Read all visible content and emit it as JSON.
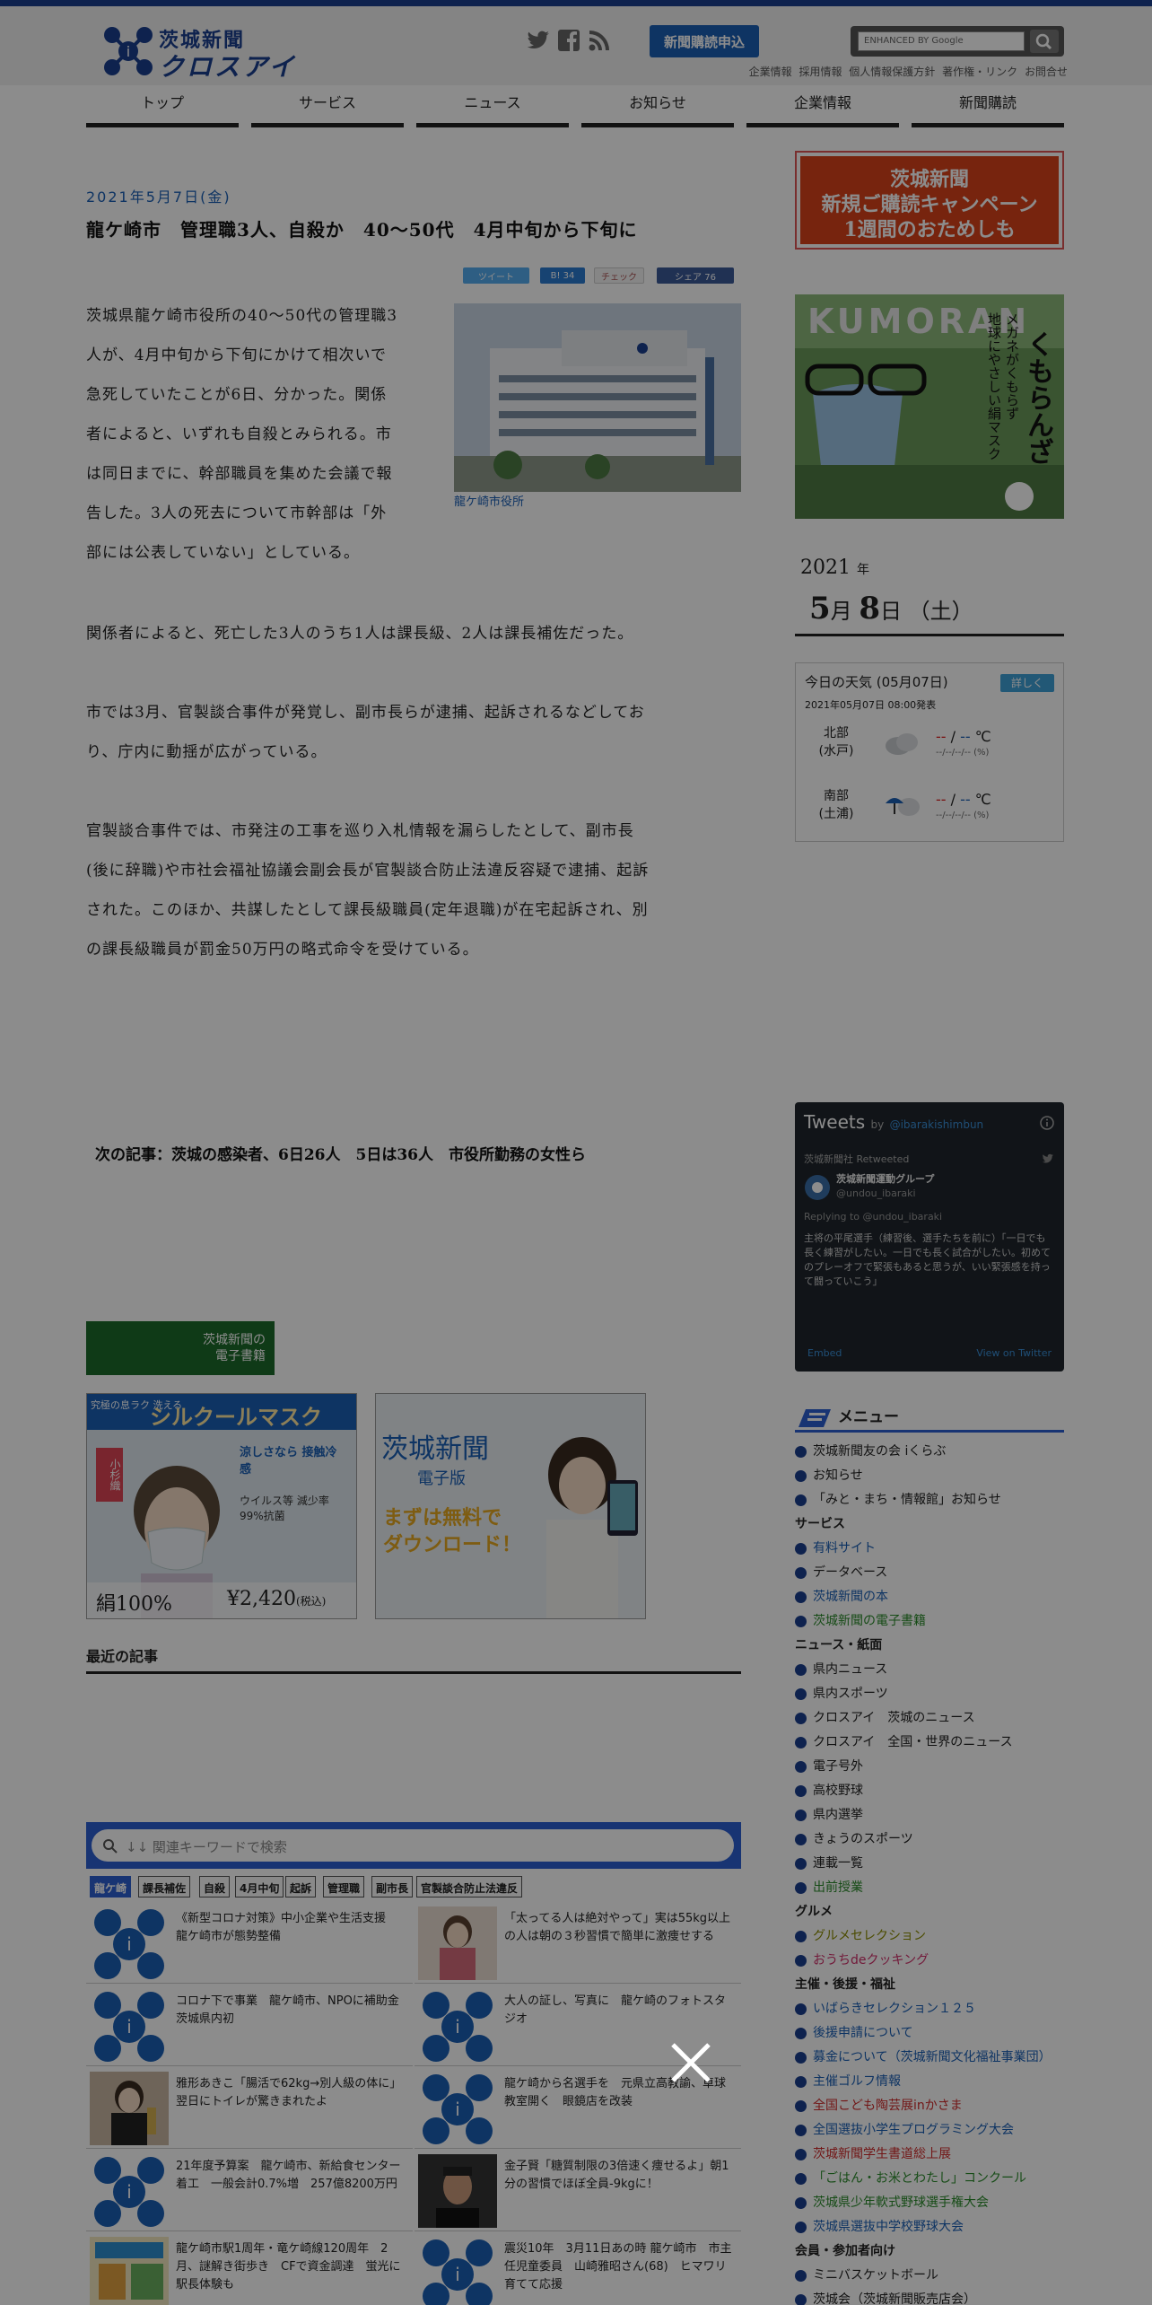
{
  "header": {
    "logo_line1": "茨城新聞",
    "logo_line2": "クロスアイ",
    "subscribe": "新聞購読申込",
    "search_placeholder": "ENHANCED BY Google",
    "toplinks": [
      "企業情報",
      "採用情報",
      "個人情報保護方針",
      "著作権・リンク",
      "お問合せ"
    ]
  },
  "nav": [
    "トップ",
    "サービス",
    "ニュース",
    "お知らせ",
    "企業情報",
    "新聞購読"
  ],
  "article": {
    "date": "2021年5月7日(金)",
    "title": "龍ケ崎市　管理職3人、自殺か　40〜50代　4月中旬から下旬に",
    "share": {
      "tweet": "ツイート",
      "hatena": "B! 34",
      "check": "チェック",
      "facebook": "シェア 76"
    },
    "photo_caption": "龍ケ崎市役所",
    "p1": [
      "茨城県龍ケ崎市役所の40〜50代の管理職3",
      "人が、4月中旬から下旬にかけて相次いで",
      "急死していたことが6日、分かった。関係",
      "者によると、いずれも自殺とみられる。市",
      "は同日までに、幹部職員を集めた会議で報",
      "告した。3人の死去について市幹部は「外",
      "部には公表していない」としている。"
    ],
    "p2": [
      "関係者によると、死亡した3人のうち1人は課長級、2人は課長補佐だった。"
    ],
    "p3": [
      "市では3月、官製談合事件が発覚し、副市長らが逮捕、起訴されるなどしてお",
      "り、庁内に動揺が広がっている。"
    ],
    "p4": [
      "官製談合事件では、市発注の工事を巡り入札情報を漏らしたとして、副市長",
      "(後に辞職)や市社会福祉協議会副会長が官製談合防止法違反容疑で逮捕、起訴",
      "された。このほか、共謀したとして課長級職員(定年退職)が在宅起訴され、別",
      "の課長級職員が罰金50万円の略式命令を受けている。"
    ],
    "next_label": "次の記事：",
    "next_title": "茨城の感染者、6日26人　5日は36人　市役所勤務の女性ら"
  },
  "ads": {
    "ebook": [
      "茨城新聞の",
      "電子書籍"
    ],
    "mask_top": "究極の息ラク 洗える",
    "mask_name": "シルクールマスク",
    "mask_brand": "小杉織",
    "mask_cool": "涼しさなら 接触冷感",
    "mask_virus": "ウイルス等 減少率99%抗菌",
    "mask_silk": "絹100%",
    "mask_price": "¥2,420",
    "mask_tax": "(税込)",
    "ebook2_title": "茨城新聞",
    "ebook2_sub": "電子版",
    "ebook2_msg1": "まずは無料で",
    "ebook2_msg2": "ダウンロード！"
  },
  "recent": {
    "heading": "最近の記事",
    "search_placeholder": "↓↓ 関連キーワードで検索",
    "tags": [
      "龍ケ崎",
      "課長補佐",
      "自殺",
      "4月中旬",
      "起訴",
      "管理職",
      "副市長",
      "官製談合防止法違反"
    ],
    "cards": [
      "《新型コロナ対策》中小企業や生活支援　龍ケ崎市が態勢整備",
      "「太ってる人は絶対やって」実は55kg以上の人は朝の３秒習慣で簡単に激痩せする",
      "コロナ下で事業　龍ケ崎市、NPOに補助金　茨城県内初",
      "大人の証し、写真に　龍ケ崎のフォトスタジオ",
      "雅形あきこ「腸活で62kg→別人級の体に」翌日にトイレが驚きまれたよ",
      "龍ケ崎から名選手を　元県立高教諭、卓球教室開く　眼鏡店を改装",
      "21年度予算案　龍ケ崎市、新給食センター着工　一般会計0.7%増　257億8200万円",
      "金子賢「糖質制限の3倍速く痩せるよ」朝1分の習慣でほぼ全員-9kgに！",
      "龍ケ崎市駅1周年・竜ケ崎線120周年　2月、謎解き街歩き　CFで資金調達　蛍光に駅長体験も",
      "震災10年　3月11日あの時 龍ケ崎市　市主任児童委員　山崎雅昭さん(68)　ヒマワリ育てて応援"
    ]
  },
  "sidebar": {
    "campaign": [
      "茨城新聞",
      "新規ご購読キャンペーン",
      "1週間のおためしも"
    ],
    "mask_ad": [
      "メガネがくもらず",
      "地球にやさしい絹マスク",
      "くもらんざ"
    ],
    "mask_ad_brand": "KUMORAN",
    "cal_year": "2021",
    "cal_year_unit": "年",
    "cal_month": "5",
    "cal_month_unit": "月",
    "cal_day": "8",
    "cal_day_unit": "日",
    "cal_weekday": "（土）",
    "weather": {
      "title": "今日の天気 (05月07日)",
      "detail": "詳しく",
      "issued": "2021年05月07日 08:00発表",
      "rows": [
        {
          "region": "北部",
          "city": "(水戸)",
          "high": "--",
          "low": "--",
          "unit": "℃",
          "pct": "--/--/--/-- (%)"
        },
        {
          "region": "南部",
          "city": "(土浦)",
          "high": "--",
          "low": "--",
          "unit": "℃",
          "pct": "--/--/--/-- (%)"
        }
      ]
    },
    "tweets": {
      "title": "Tweets",
      "by": "by",
      "handle": "@ibarakishimbun",
      "retweeted": "茨城新聞社 Retweeted",
      "name": "茨城新聞運動グループ",
      "user": "@undou_ibaraki",
      "reply": "Replying to @undou_ibaraki",
      "text": "主将の平尾選手（練習後、選手たちを前に）「一日でも長く練習がしたい。一日でも長く試合がしたい。初めてのプレーオフで緊張もあると思うが、いい緊張感を持って闘っていこう」",
      "embed": "Embed",
      "view": "View on Twitter"
    },
    "menu_title": "メニュー",
    "menu": [
      {
        "t": "茨城新聞友の会 iくらぶ",
        "c": "plain"
      },
      {
        "t": "お知らせ",
        "c": "plain"
      },
      {
        "t": "「みと・まち・情報館」お知らせ",
        "c": "plain"
      },
      {
        "t": "サービス",
        "c": "section"
      },
      {
        "t": "有料サイト",
        "c": "blue"
      },
      {
        "t": "データベース",
        "c": "plain"
      },
      {
        "t": "茨城新聞の本",
        "c": "blue"
      },
      {
        "t": "茨城新聞の電子書籍",
        "c": "green"
      },
      {
        "t": "ニュース・紙面",
        "c": "section"
      },
      {
        "t": "県内ニュース",
        "c": "plain"
      },
      {
        "t": "県内スポーツ",
        "c": "plain"
      },
      {
        "t": "クロスアイ　茨城のニュース",
        "c": "plain"
      },
      {
        "t": "クロスアイ　全国・世界のニュース",
        "c": "plain"
      },
      {
        "t": "電子号外",
        "c": "plain"
      },
      {
        "t": "高校野球",
        "c": "plain"
      },
      {
        "t": "県内選挙",
        "c": "plain"
      },
      {
        "t": "きょうのスポーツ",
        "c": "plain"
      },
      {
        "t": "連載一覧",
        "c": "plain"
      },
      {
        "t": "出前授業",
        "c": "green"
      },
      {
        "t": "グルメ",
        "c": "section"
      },
      {
        "t": "グルメセレクション",
        "c": "olive"
      },
      {
        "t": "おうちdeクッキング",
        "c": "pink"
      },
      {
        "t": "主催・後援・福祉",
        "c": "section"
      },
      {
        "t": "いばらきセレクション１２５",
        "c": "blue"
      },
      {
        "t": "後援申請について",
        "c": "blue"
      },
      {
        "t": "募金について（茨城新聞文化福祉事業団）",
        "c": "blue"
      },
      {
        "t": "主催ゴルフ情報",
        "c": "blue"
      },
      {
        "t": "全国こども陶芸展inかさま",
        "c": "red"
      },
      {
        "t": "全国選抜小学生プログラミング大会",
        "c": "blue"
      },
      {
        "t": "茨城新聞学生書道総上展",
        "c": "red"
      },
      {
        "t": "「ごはん・お米とわたし」コンクール",
        "c": "green"
      },
      {
        "t": "茨城県少年軟式野球選手権大会",
        "c": "green"
      },
      {
        "t": "茨城県選抜中学校野球大会",
        "c": "blue"
      },
      {
        "t": "会員・参加者向け",
        "c": "section"
      },
      {
        "t": "ミニバスケットボール",
        "c": "plain"
      },
      {
        "t": "茨城会（茨城新聞販売店会）",
        "c": "plain"
      }
    ]
  },
  "colors": {
    "brand": "#1b3f8f",
    "accent": "#2d5fd1",
    "overlay": "rgba(0,0,0,0.45)"
  }
}
